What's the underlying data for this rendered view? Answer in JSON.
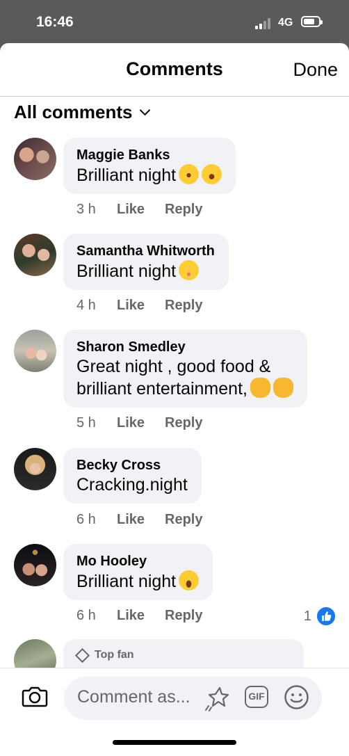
{
  "status_bar": {
    "time": "16:46",
    "network": "4G"
  },
  "header": {
    "title": "Comments",
    "done_label": "Done"
  },
  "filter": {
    "label": "All comments"
  },
  "comments": [
    {
      "name": "Maggie Banks",
      "lines": [
        "Brilliant night"
      ],
      "emojis": [
        "rolling-on-floor-laughing",
        "tears-of-joy"
      ],
      "time": "3 h",
      "like_label": "Like",
      "reply_label": "Reply"
    },
    {
      "name": "Samantha Whitworth",
      "lines": [
        "Brilliant night"
      ],
      "emojis": [
        "smiling-face"
      ],
      "time": "4 h",
      "like_label": "Like",
      "reply_label": "Reply"
    },
    {
      "name": "Sharon Smedley",
      "lines": [
        "Great night , good food &",
        "brilliant entertainment,"
      ],
      "emojis": [
        "clapping-hands",
        "clapping-hands"
      ],
      "time": "5 h",
      "like_label": "Like",
      "reply_label": "Reply"
    },
    {
      "name": "Becky Cross",
      "lines": [
        "Cracking.night"
      ],
      "emojis": [],
      "time": "6 h",
      "like_label": "Like",
      "reply_label": "Reply"
    },
    {
      "name": "Mo Hooley",
      "lines": [
        "Brilliant night"
      ],
      "emojis": [
        "grinning-face"
      ],
      "time": "6 h",
      "like_label": "Like",
      "reply_label": "Reply",
      "reaction_count": "1"
    }
  ],
  "partial_comment": {
    "badge": "Top fan"
  },
  "composer": {
    "placeholder": "Comment as..."
  },
  "colors": {
    "accent": "#1877f2",
    "bubble": "#f0f2f5",
    "meta": "#65676b"
  }
}
